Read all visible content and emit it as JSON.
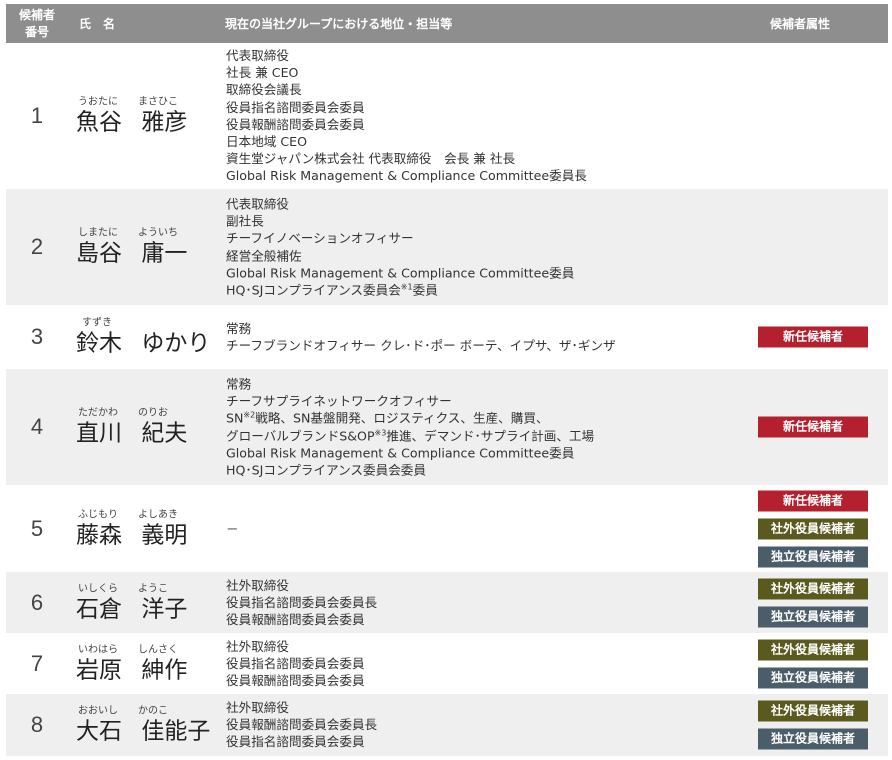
{
  "header": {
    "num_line1": "候補者",
    "num_line2": "番号",
    "name": "氏名",
    "position": "現在の当社グループにおける地位・担当等",
    "attributes": "候補者属性"
  },
  "rows": [
    {
      "num": "1",
      "ruby_family": "うおたに",
      "ruby_given": "まさひこ",
      "family": "魚谷",
      "given": "雅彦",
      "positions": [
        "代表取締役",
        "社長 兼 CEO",
        "取締役会議長",
        "役員指名諮問委員会委員",
        "役員報酬諮問委員会委員",
        "日本地域 CEO",
        "資生堂ジャパン株式会社 代表取締役　会長 兼 社長",
        "Global Risk Management & Compliance Committee委員長"
      ],
      "badges": []
    },
    {
      "num": "2",
      "ruby_family": "しまたに",
      "ruby_given": "よういち",
      "family": "島谷",
      "given": "庸一",
      "positions": [
        "代表取締役",
        "副社長",
        "チーフイノベーションオフィサー",
        "経営全般補佐",
        "Global Risk Management & Compliance Committee委員"
      ],
      "pos_last_pre": "HQ･SJコンプライアンス委員会",
      "pos_last_sup": "※1",
      "pos_last_post": "委員",
      "badges": []
    },
    {
      "num": "3",
      "ruby_family": "すずき",
      "ruby_given": "",
      "family": "鈴木",
      "given": "ゆかり",
      "positions": [
        "常務",
        "チーフブランドオフィサー クレ･ド･ポー ボーテ、イプサ、ザ･ギンザ"
      ],
      "badges": [
        {
          "type": "new",
          "label": "新任候補者"
        }
      ]
    },
    {
      "num": "4",
      "ruby_family": "ただかわ",
      "ruby_given": "のりお",
      "family": "直川",
      "given": "紀夫",
      "positions": [
        "常務",
        "チーフサプライネットワークオフィサー"
      ],
      "pos_sn_pre": "SN",
      "pos_sn_sup": "※2",
      "pos_sn_post": "戦略、SN基盤開発、ロジスティクス、生産、購買、",
      "pos_gb_pre": "グローバルブランドS&OP",
      "pos_gb_sup": "※3",
      "pos_gb_post": "推進、デマンド･サプライ計画、工場",
      "positions_after": [
        "Global Risk Management & Compliance Committee委員",
        "HQ･SJコンプライアンス委員会委員"
      ],
      "badges": [
        {
          "type": "new",
          "label": "新任候補者"
        }
      ]
    },
    {
      "num": "5",
      "ruby_family": "ふじもり",
      "ruby_given": "よしあき",
      "family": "藤森",
      "given": "義明",
      "positions": [
        "－"
      ],
      "badges": [
        {
          "type": "new",
          "label": "新任候補者"
        },
        {
          "type": "ext",
          "label": "社外役員候補者"
        },
        {
          "type": "ind",
          "label": "独立役員候補者"
        }
      ]
    },
    {
      "num": "6",
      "ruby_family": "いしくら",
      "ruby_given": "ようこ",
      "family": "石倉",
      "given": "洋子",
      "positions": [
        "社外取締役",
        "役員指名諮問委員会委員長",
        "役員報酬諮問委員会委員"
      ],
      "badges": [
        {
          "type": "ext",
          "label": "社外役員候補者"
        },
        {
          "type": "ind",
          "label": "独立役員候補者"
        }
      ]
    },
    {
      "num": "7",
      "ruby_family": "いわはら",
      "ruby_given": "しんさく",
      "family": "岩原",
      "given": "紳作",
      "positions": [
        "社外取締役",
        "役員指名諮問委員会委員",
        "役員報酬諮問委員会委員"
      ],
      "badges": [
        {
          "type": "ext",
          "label": "社外役員候補者"
        },
        {
          "type": "ind",
          "label": "独立役員候補者"
        }
      ]
    },
    {
      "num": "8",
      "ruby_family": "おおいし",
      "ruby_given": "かのこ",
      "family": "大石",
      "given": "佳能子",
      "positions": [
        "社外取締役",
        "役員報酬諮問委員会委員長",
        "役員指名諮問委員会委員"
      ],
      "badges": [
        {
          "type": "ext",
          "label": "社外役員候補者"
        },
        {
          "type": "ind",
          "label": "独立役員候補者"
        }
      ]
    }
  ]
}
